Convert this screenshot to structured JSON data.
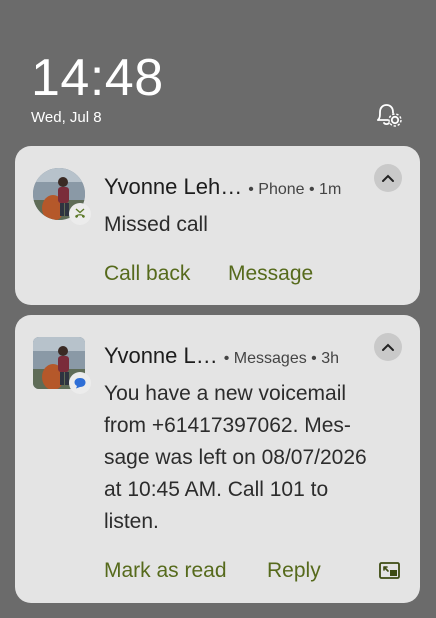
{
  "lockscreen": {
    "time": "14:48",
    "date": "Wed, Jul 8"
  },
  "notifications": [
    {
      "name": "Yvonne Leh…",
      "app_meta": "• Phone • 1m",
      "body": "Missed call",
      "actions": [
        "Call back",
        "Message"
      ]
    },
    {
      "name": "Yvonne L…",
      "app_meta": "• Messages • 3h",
      "body_lines": [
        "You have a new voicemail",
        "from +61417397062. Mes-",
        "sage was left on 08/07/2026",
        "at 10:45 AM. Call 101 to",
        "listen."
      ],
      "actions": [
        "Mark as read",
        "Reply"
      ]
    }
  ],
  "colors": {
    "background": "#6b6b6b",
    "card": "#e4e4e4",
    "action_text": "#566a1c"
  },
  "icons": [
    "notification-settings-icon",
    "missed-call-icon",
    "message-bubble-icon",
    "chevron-up-icon",
    "picture-in-picture-icon"
  ]
}
